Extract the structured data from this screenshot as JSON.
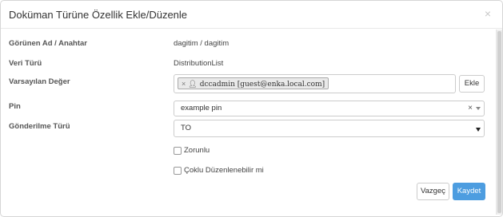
{
  "dialog": {
    "title": "Doküman Türüne Özellik Ekle/Düzenle",
    "close_glyph": "×"
  },
  "fields": {
    "display_name": {
      "label": "Görünen Ad / Anahtar",
      "value": "dagitim / dagitim"
    },
    "data_type": {
      "label": "Veri Türü",
      "value": "DistributionList"
    },
    "default_value": {
      "label": "Varsayılan Değer",
      "tag": "dccadmin [guest@enka.local.com]",
      "tag_remove_glyph": "×",
      "add_button": "Ekle"
    },
    "pin": {
      "label": "Pin",
      "value": "example pin",
      "clear_glyph": "×"
    },
    "send_type": {
      "label": "Gönderilme Türü",
      "value": "TO"
    }
  },
  "checkboxes": {
    "required": {
      "label": "Zorunlu",
      "checked": false
    },
    "multi_edit": {
      "label": "Çoklu Düzenlenebilir mi",
      "checked": false
    }
  },
  "footer": {
    "cancel_label": "Vazgeç",
    "save_label": "Kaydet"
  },
  "colors": {
    "primary": "#4d9de0",
    "border": "#cccccc",
    "tag_bg": "#e9e9e9"
  }
}
